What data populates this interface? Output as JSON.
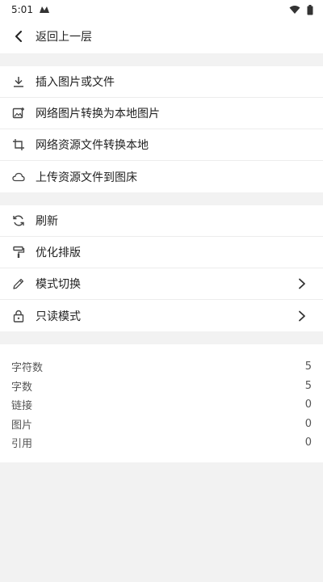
{
  "status": {
    "time": "5:01"
  },
  "header": {
    "back_label": "返回上一层"
  },
  "group1": [
    {
      "label": "插入图片或文件",
      "icon": "download-icon"
    },
    {
      "label": "网络图片转换为本地图片",
      "icon": "image-add-icon"
    },
    {
      "label": "网络资源文件转换本地",
      "icon": "crop-icon"
    },
    {
      "label": "上传资源文件到图床",
      "icon": "cloud-icon"
    }
  ],
  "group2": [
    {
      "label": "刷新",
      "icon": "refresh-icon"
    },
    {
      "label": "优化排版",
      "icon": "paint-roller-icon"
    },
    {
      "label": "模式切换",
      "icon": "pencil-icon",
      "chevron": true
    },
    {
      "label": "只读模式",
      "icon": "lock-icon",
      "chevron": true
    }
  ],
  "stats": [
    {
      "label": "字符数",
      "value": "5"
    },
    {
      "label": "字数",
      "value": "5"
    },
    {
      "label": "链接",
      "value": "0"
    },
    {
      "label": "图片",
      "value": "0"
    },
    {
      "label": "引用",
      "value": "0"
    }
  ]
}
